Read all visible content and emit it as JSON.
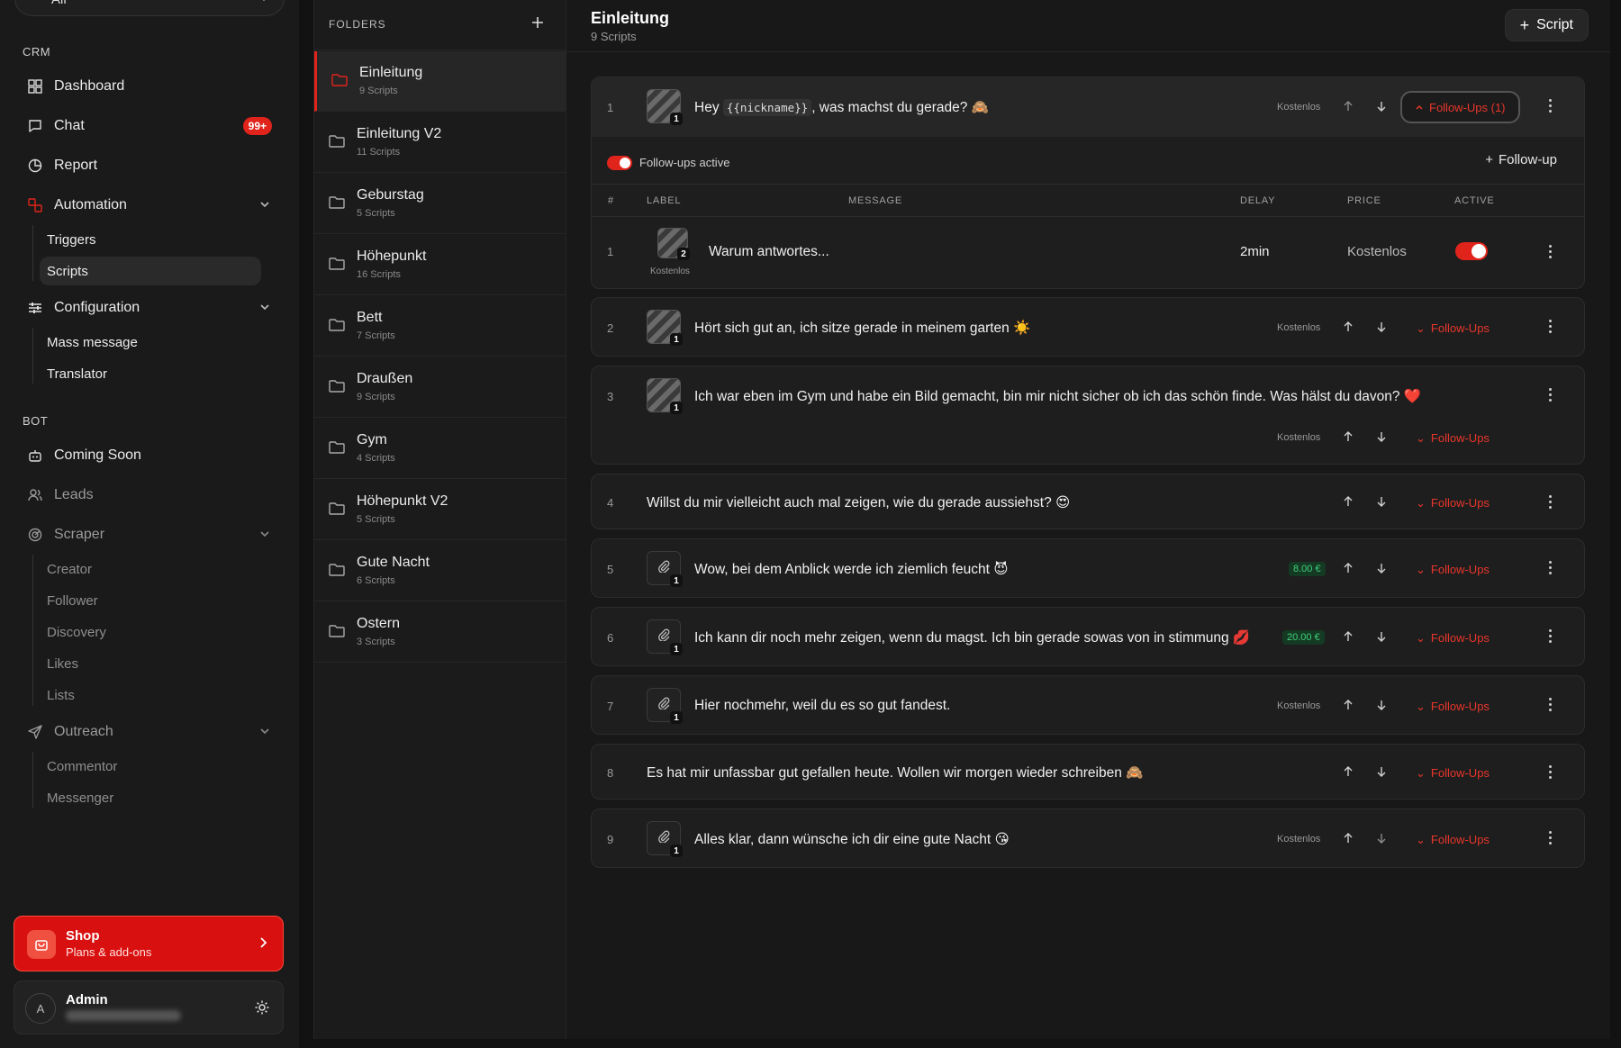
{
  "sidebar": {
    "workspace": "All",
    "sections": {
      "crm": "CRM",
      "bot": "BOT"
    },
    "items": {
      "dashboard": "Dashboard",
      "chat": "Chat",
      "chat_badge": "99+",
      "report": "Report",
      "automation": "Automation",
      "triggers": "Triggers",
      "scripts": "Scripts",
      "configuration": "Configuration",
      "mass_message": "Mass message",
      "translator": "Translator",
      "coming_soon": "Coming Soon",
      "leads": "Leads",
      "scraper": "Scraper",
      "creator": "Creator",
      "follower": "Follower",
      "discovery": "Discovery",
      "likes": "Likes",
      "lists": "Lists",
      "outreach": "Outreach",
      "commentor": "Commentor",
      "messenger": "Messenger"
    },
    "shop": {
      "title": "Shop",
      "subtitle": "Plans & add-ons"
    },
    "user": {
      "avatar": "A",
      "name": "Admin"
    }
  },
  "folders": {
    "header": "FOLDERS",
    "items": [
      {
        "name": "Einleitung",
        "count": "9 Scripts"
      },
      {
        "name": "Einleitung V2",
        "count": "11 Scripts"
      },
      {
        "name": "Geburstag",
        "count": "5 Scripts"
      },
      {
        "name": "Höhepunkt",
        "count": "16 Scripts"
      },
      {
        "name": "Bett",
        "count": "7 Scripts"
      },
      {
        "name": "Draußen",
        "count": "9 Scripts"
      },
      {
        "name": "Gym",
        "count": "4 Scripts"
      },
      {
        "name": "Höhepunkt V2",
        "count": "5 Scripts"
      },
      {
        "name": "Gute Nacht",
        "count": "6 Scripts"
      },
      {
        "name": "Ostern",
        "count": "3 Scripts"
      }
    ]
  },
  "main": {
    "title": "Einleitung",
    "subtitle": "9 Scripts",
    "add_script": "Script",
    "followups_active": "Follow-ups active",
    "add_followup": "Follow-up",
    "table_headers": {
      "num": "#",
      "label": "LABEL",
      "message": "MESSAGE",
      "delay": "DELAY",
      "price": "PRICE",
      "active": "ACTIVE"
    },
    "followup_row": {
      "num": "1",
      "media_count": "2",
      "label": "Kostenlos",
      "message": "Warum antwortes...",
      "delay": "2min",
      "price": "Kostenlos"
    },
    "scripts": [
      {
        "num": "1",
        "msg_pre": "Hey ",
        "msg_code": "{{nickname}}",
        "msg_post": ", was machst du gerade? 🙈",
        "price": "Kostenlos",
        "media": "1",
        "followups": "Follow-Ups (1)"
      },
      {
        "num": "2",
        "msg": "Hört sich gut an, ich sitze gerade in meinem garten ☀️",
        "price": "Kostenlos",
        "media": "1",
        "followups": "Follow-Ups"
      },
      {
        "num": "3",
        "msg": "Ich war eben im Gym und habe ein Bild gemacht, bin mir nicht sicher ob ich das schön finde. Was hälst du davon? ❤️",
        "price": "Kostenlos",
        "media": "1",
        "followups": "Follow-Ups"
      },
      {
        "num": "4",
        "msg": "Willst du mir vielleicht auch mal zeigen, wie du gerade aussiehst? 😍",
        "followups": "Follow-Ups"
      },
      {
        "num": "5",
        "msg": "Wow, bei dem Anblick werde ich ziemlich feucht 😈",
        "price": "8.00 €",
        "media": "1",
        "followups": "Follow-Ups"
      },
      {
        "num": "6",
        "msg": "Ich kann dir noch mehr zeigen, wenn du magst. Ich bin gerade sowas von in stimmung 💋",
        "price": "20.00 €",
        "media": "1",
        "followups": "Follow-Ups"
      },
      {
        "num": "7",
        "msg": "Hier nochmehr, weil du es so gut fandest.",
        "price": "Kostenlos",
        "media": "1",
        "followups": "Follow-Ups"
      },
      {
        "num": "8",
        "msg": "Es hat mir unfassbar gut gefallen heute. Wollen wir morgen wieder schreiben 🙈",
        "followups": "Follow-Ups"
      },
      {
        "num": "9",
        "msg": "Alles klar, dann wünsche ich dir eine gute Nacht 😘",
        "price": "Kostenlos",
        "media": "1",
        "followups": "Follow-Ups"
      }
    ]
  },
  "colors": {
    "accent": "#e0241b",
    "price_green": "#3fd07a",
    "background": "#121212"
  }
}
